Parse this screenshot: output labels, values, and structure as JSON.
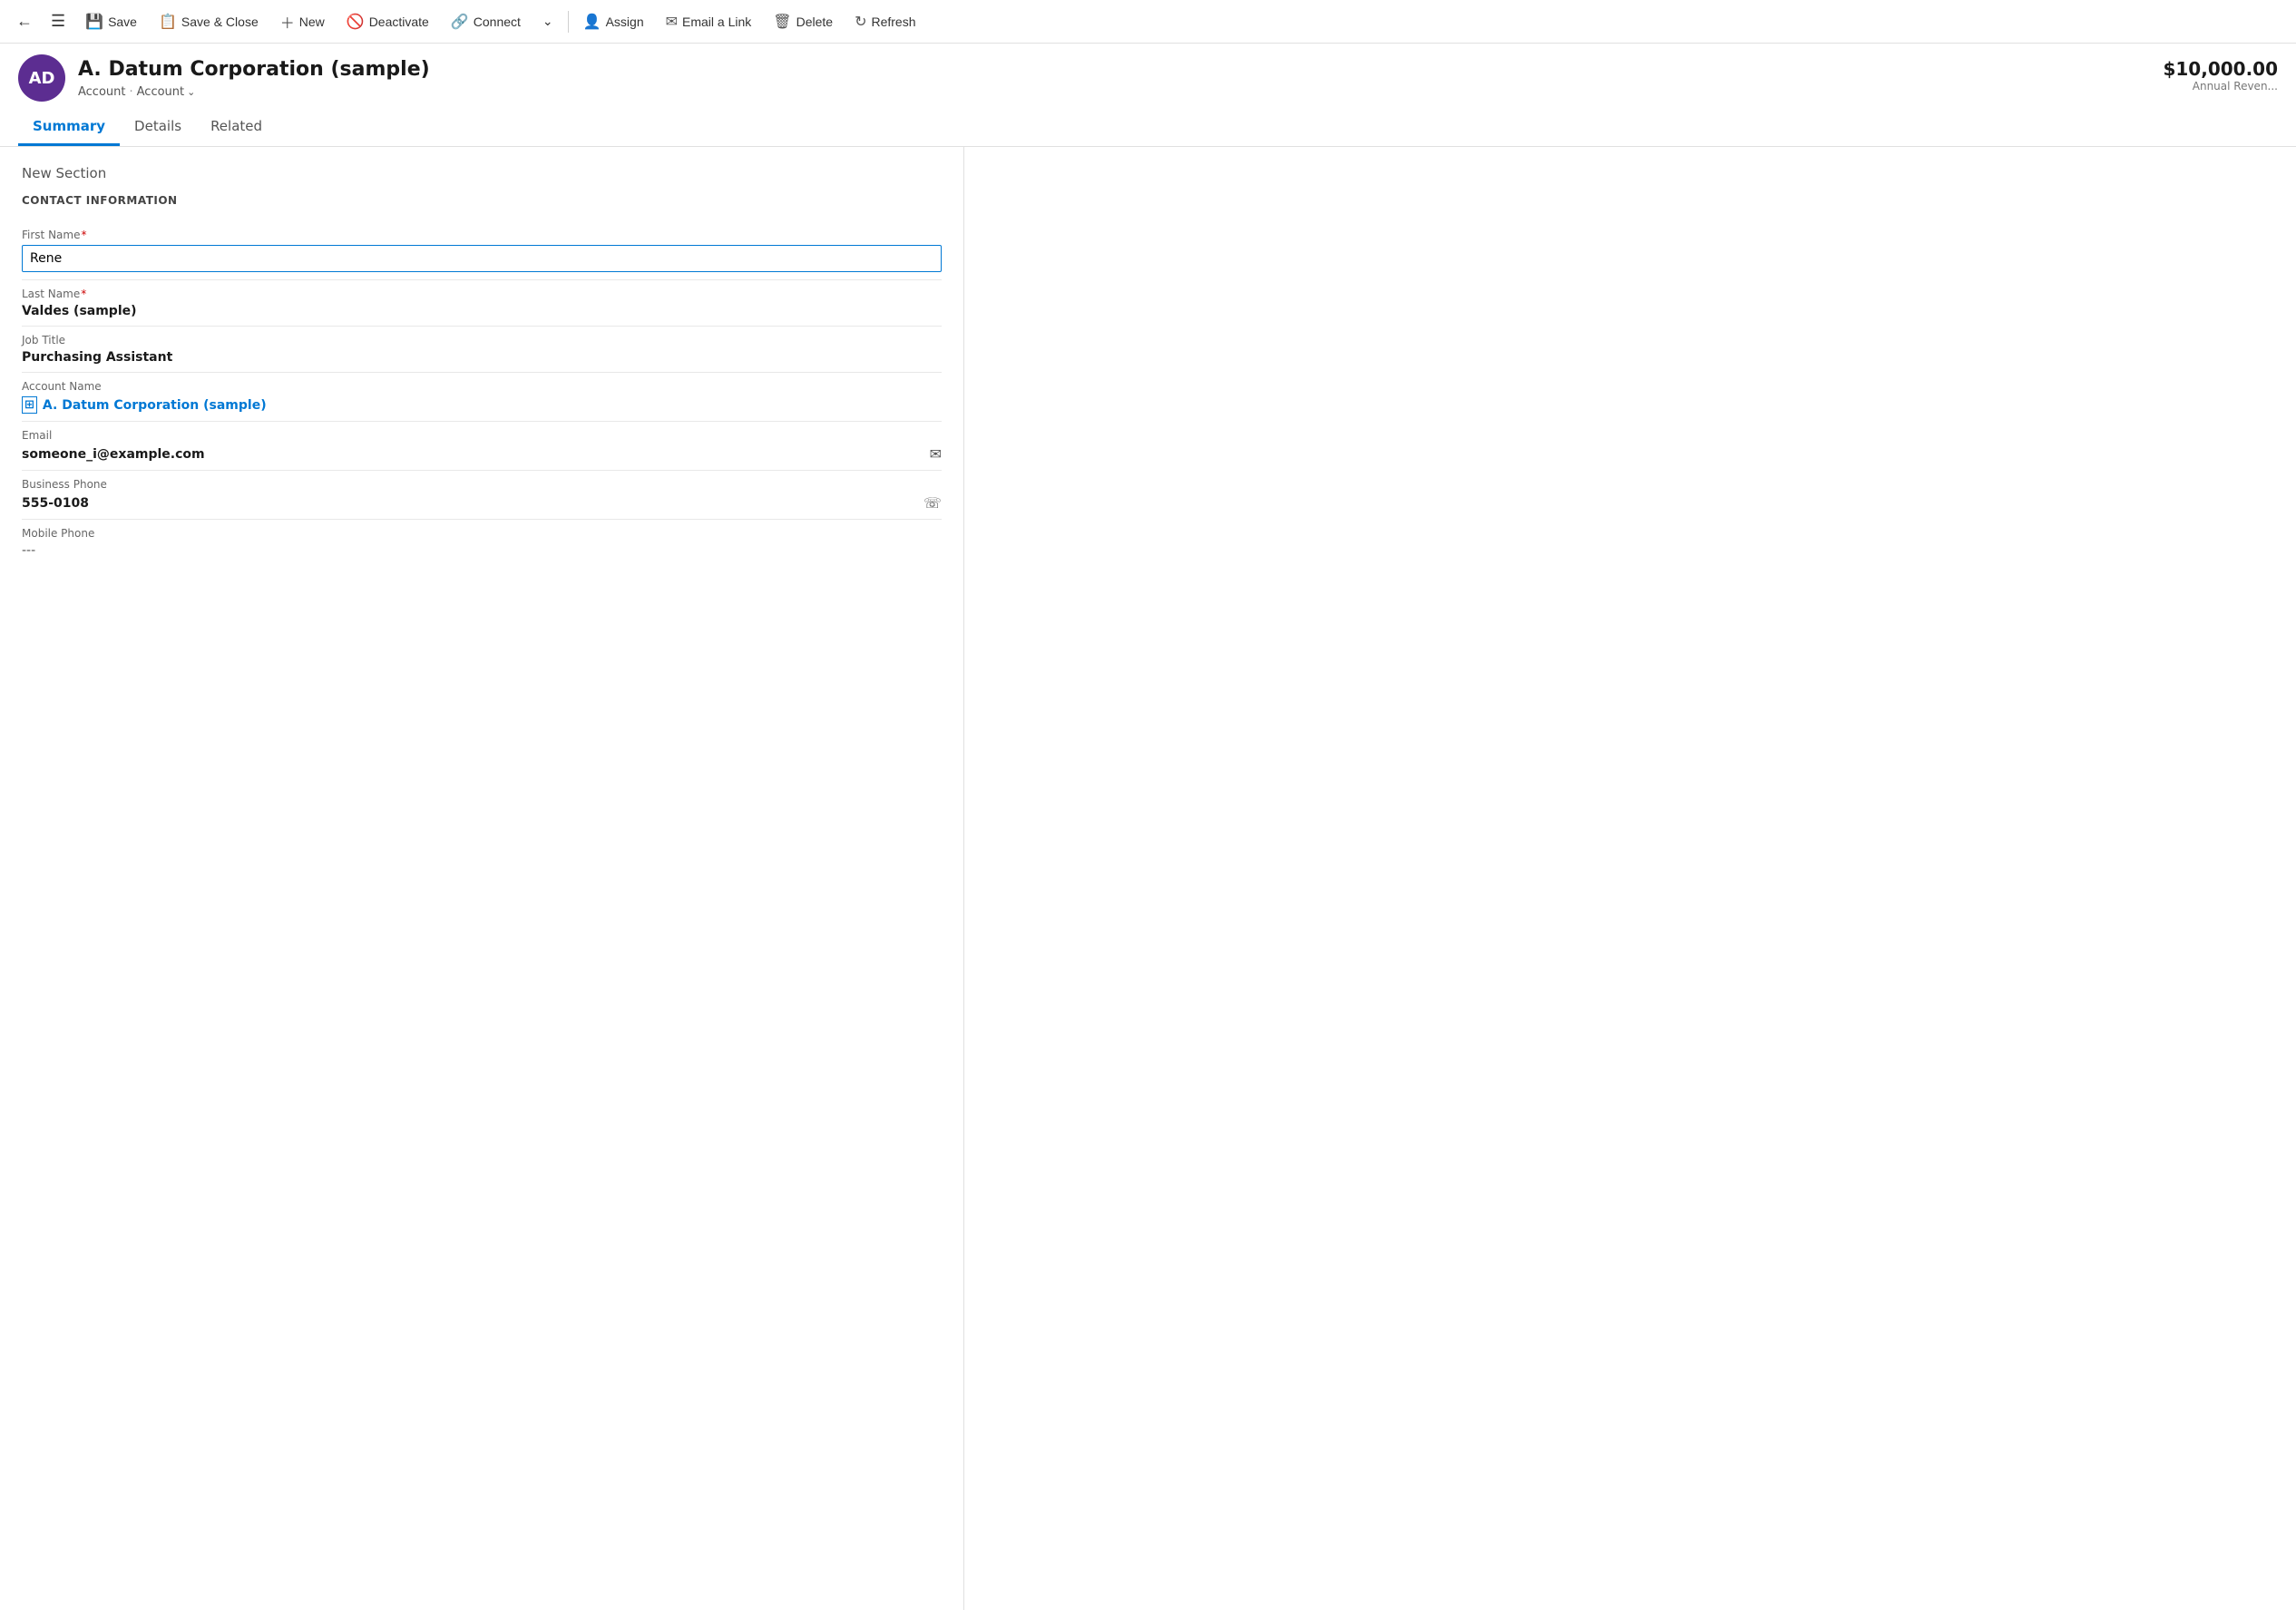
{
  "toolbar": {
    "back_label": "←",
    "record_icon": "☰",
    "save_label": "Save",
    "save_close_label": "Save & Close",
    "new_label": "New",
    "deactivate_label": "Deactivate",
    "connect_label": "Connect",
    "more_label": "⌄",
    "assign_label": "Assign",
    "email_link_label": "Email a Link",
    "delete_label": "Delete",
    "refresh_label": "Refresh"
  },
  "record": {
    "avatar_initials": "AD",
    "avatar_bg": "#5c2d91",
    "title": "A. Datum Corporation (sample)",
    "breadcrumb1": "Account",
    "breadcrumb2": "Account",
    "revenue_amount": "$10,000.00",
    "revenue_label": "Annual Reven..."
  },
  "tabs": [
    {
      "id": "summary",
      "label": "Summary",
      "active": true
    },
    {
      "id": "details",
      "label": "Details",
      "active": false
    },
    {
      "id": "related",
      "label": "Related",
      "active": false
    }
  ],
  "section": {
    "new_section_label": "New Section",
    "contact_info_label": "CONTACT INFORMATION"
  },
  "fields": {
    "first_name_label": "First Name",
    "first_name_value": "Rene",
    "last_name_label": "Last Name",
    "last_name_value": "Valdes (sample)",
    "job_title_label": "Job Title",
    "job_title_value": "Purchasing Assistant",
    "account_name_label": "Account Name",
    "account_name_value": "A. Datum Corporation (sample)",
    "email_label": "Email",
    "email_value": "someone_i@example.com",
    "business_phone_label": "Business Phone",
    "business_phone_value": "555-0108",
    "mobile_phone_label": "Mobile Phone",
    "mobile_phone_value": "---"
  }
}
